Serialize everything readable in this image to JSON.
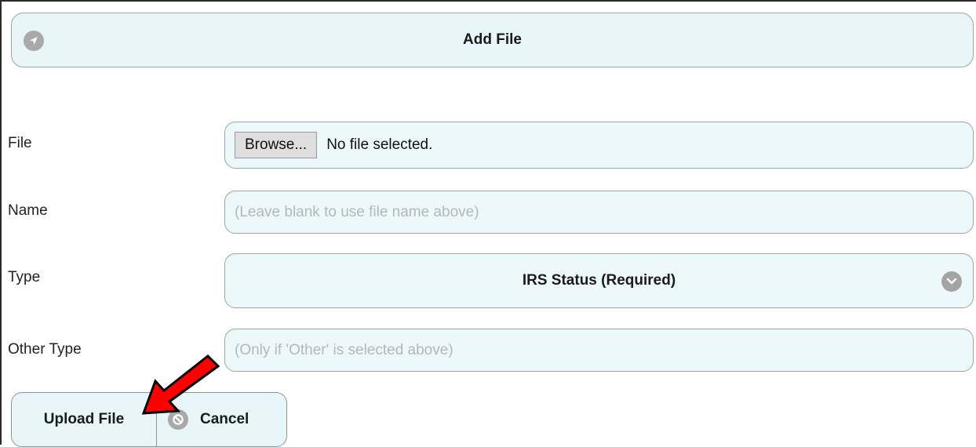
{
  "header": {
    "title": "Add File",
    "icon": "navigation-icon"
  },
  "form": {
    "file": {
      "label": "File",
      "browse_label": "Browse...",
      "status": "No file selected."
    },
    "name": {
      "label": "Name",
      "placeholder": "(Leave blank to use file name above)"
    },
    "type": {
      "label": "Type",
      "selected": "IRS Status (Required)",
      "icon": "chevron-down-icon"
    },
    "other_type": {
      "label": "Other Type",
      "placeholder": "(Only if 'Other' is selected above)"
    }
  },
  "actions": {
    "upload_label": "Upload File",
    "cancel_label": "Cancel",
    "cancel_icon": "cancel-icon"
  },
  "annotation": {
    "arrow_color": "#ff0000",
    "points_to": "upload-file-button"
  },
  "colors": {
    "panel_bg": "#e8f6f9",
    "border": "#9aa5a8",
    "icon_gray": "#a9a9a9",
    "placeholder": "#b4b8ba"
  }
}
